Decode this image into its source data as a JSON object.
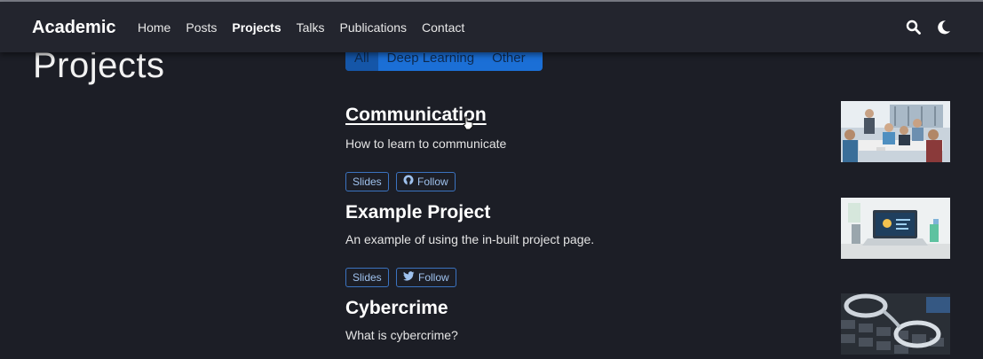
{
  "navbar": {
    "brand": "Academic",
    "links": [
      "Home",
      "Posts",
      "Projects",
      "Talks",
      "Publications",
      "Contact"
    ],
    "active": "Projects",
    "icons": [
      "search-icon",
      "moon-icon"
    ]
  },
  "page": {
    "title": "Projects"
  },
  "filters": [
    "All",
    "Deep Learning",
    "Other"
  ],
  "projects": [
    {
      "title": "Communication",
      "summary": "How to learn to communicate",
      "buttons": [
        "Slides",
        "Follow"
      ],
      "follow_icon": "github-icon"
    },
    {
      "title": "Example Project",
      "summary": "An example of using the in-built project page.",
      "buttons": [
        "Slides",
        "Follow"
      ],
      "follow_icon": "twitter-icon"
    },
    {
      "title": "Cybercrime",
      "summary": "What is cybercrime?"
    }
  ],
  "colors": {
    "background": "#1c1e26",
    "navbar": "#23252e",
    "accent": "#1b6fd6"
  }
}
